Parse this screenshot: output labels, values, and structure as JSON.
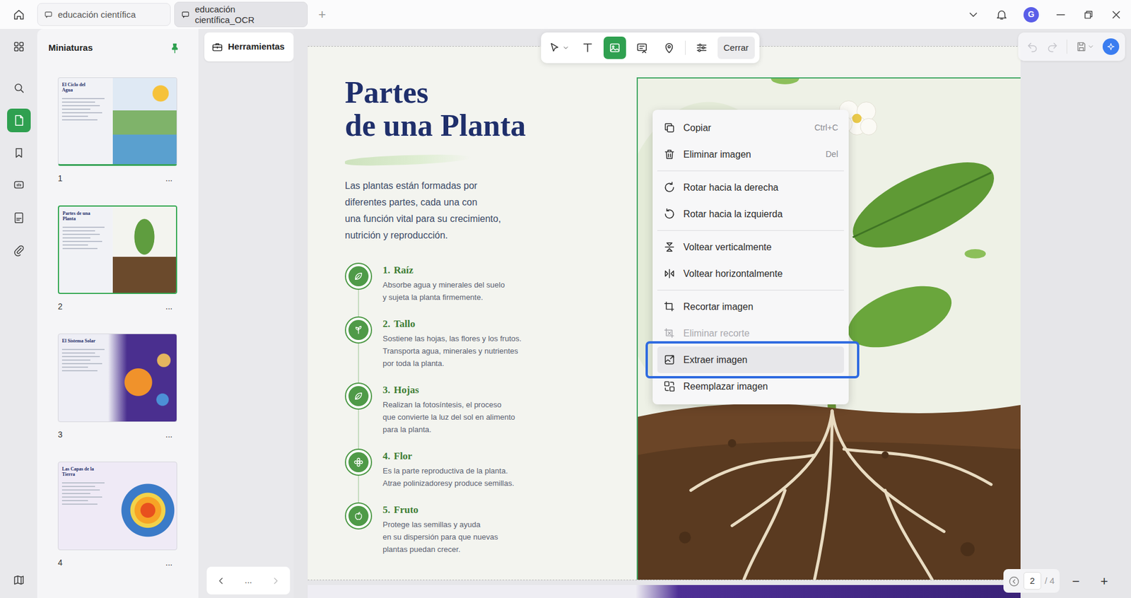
{
  "window": {
    "tabs": [
      {
        "label": "educación científica",
        "selected": false
      },
      {
        "label": "educación científica_OCR",
        "selected": true
      }
    ],
    "new_tab": "+",
    "avatar": "G"
  },
  "rail": {
    "items": [
      {
        "selected": false
      },
      {
        "selected": false
      },
      {
        "selected": true
      },
      {
        "selected": false
      },
      {
        "selected": false
      },
      {
        "selected": false
      },
      {
        "selected": false
      }
    ]
  },
  "thumbnails": {
    "title": "Miniaturas",
    "pinned": true,
    "pages": [
      {
        "title": "El Ciclo del Agua",
        "number": "1",
        "more": "...",
        "selected": false
      },
      {
        "title": "Partes de una Planta",
        "number": "2",
        "more": "...",
        "selected": true
      },
      {
        "title": "El Sistema Solar",
        "number": "3",
        "more": "...",
        "selected": false
      },
      {
        "title": "Las Capas de la Tierra",
        "number": "4",
        "more": "...",
        "selected": false
      }
    ]
  },
  "tools_panel": {
    "button": "Herramientas",
    "pager": "..."
  },
  "toolbar": {
    "tools": [
      {
        "selected": false
      },
      {
        "selected": false
      },
      {
        "selected": true
      },
      {
        "selected": false
      },
      {
        "selected": false
      },
      {
        "selected": false
      }
    ],
    "close": "Cerrar"
  },
  "history": {
    "undo": {
      "disabled": true
    },
    "redo": {
      "disabled": true
    }
  },
  "document": {
    "title_lines": [
      "Partes",
      "de una Planta"
    ],
    "intro_lines": [
      "Las plantas están formadas por",
      "diferentes partes, cada una con",
      "una función vital para su crecimiento,",
      "nutrición y reproducción."
    ],
    "parts": [
      {
        "number": "1.",
        "name": "Raíz",
        "lines": [
          "Absorbe agua y minerales del suelo",
          "y sujeta la planta firmemente."
        ]
      },
      {
        "number": "2.",
        "name": "Tallo",
        "lines": [
          "Sostiene las hojas, las flores y los frutos.",
          "Transporta agua, minerales y nutrientes",
          "por toda la planta."
        ]
      },
      {
        "number": "3.",
        "name": "Hojas",
        "lines": [
          "Realizan la fotosíntesis, el proceso",
          "que convierte la luz del sol en alimento",
          "para la planta."
        ]
      },
      {
        "number": "4.",
        "name": "Flor",
        "lines": [
          "Es la parte reproductiva de la planta.",
          "Atrae polinizadoresy produce semillas."
        ]
      },
      {
        "number": "5.",
        "name": "Fruto",
        "lines": [
          "Protege las semillas y ayuda",
          "en su dispersión para que nuevas",
          "plantas puedan crecer."
        ]
      }
    ]
  },
  "context_menu": {
    "groups": [
      [
        {
          "label": "Copiar",
          "shortcut": "Ctrl+C",
          "disabled": false,
          "selected": false
        },
        {
          "label": "Eliminar imagen",
          "shortcut": "Del",
          "disabled": false,
          "selected": false
        }
      ],
      [
        {
          "label": "Rotar hacia la derecha",
          "disabled": false,
          "selected": false
        },
        {
          "label": "Rotar hacia la izquierda",
          "disabled": false,
          "selected": false
        }
      ],
      [
        {
          "label": "Voltear verticalmente",
          "disabled": false,
          "selected": false
        },
        {
          "label": "Voltear horizontalmente",
          "disabled": false,
          "selected": false
        }
      ],
      [
        {
          "label": "Recortar imagen",
          "disabled": false,
          "selected": false
        },
        {
          "label": "Eliminar recorte",
          "disabled": true,
          "selected": false
        },
        {
          "label": "Extraer imagen",
          "disabled": false,
          "selected": true
        },
        {
          "label": "Reemplazar imagen",
          "disabled": false,
          "selected": false
        }
      ]
    ]
  },
  "page_nav": {
    "current": "2",
    "total": "/ 4",
    "zoom_out": "−",
    "zoom_in": "+"
  }
}
